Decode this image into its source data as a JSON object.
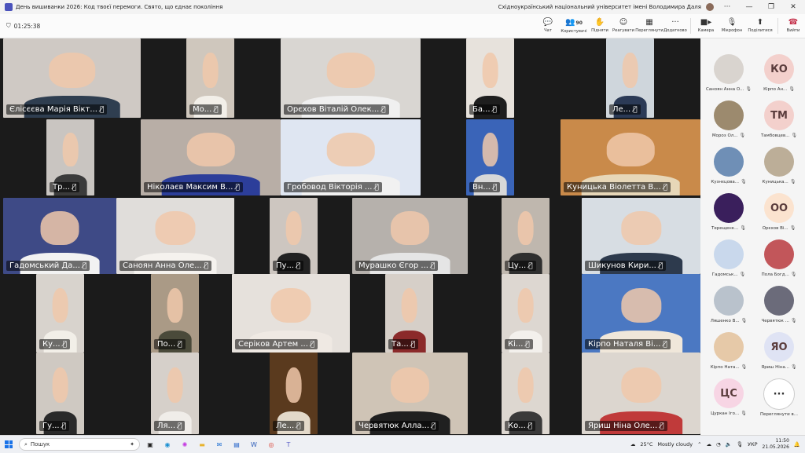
{
  "window": {
    "title": "День вишиванки 2026: Код твоєї перемоги. Свято, що єднає покоління",
    "org": "Східноукраїнський національний університет імені Володимира Даля"
  },
  "toolbar": {
    "timer": "01:25:38",
    "chat": "Чат",
    "people": "Користувачі",
    "people_count": "90",
    "raise": "Підняти",
    "react": "Реагувати",
    "view": "Переглянути",
    "more": "Додатково",
    "camera": "Камера",
    "mic": "Мікрофон",
    "share": "Поділитися",
    "leave": "Вийти"
  },
  "tiles": [
    {
      "name": "Єлісєєва Марія Вікт...",
      "bg": "#cfc9c4",
      "shirt": "#2f3e50"
    },
    {
      "name": "Мо...",
      "bg": "#cfc7bd",
      "shirt": "#f2efe9"
    },
    {
      "name": "Орєхов Віталій Олек...",
      "bg": "#d9d6d2",
      "shirt": "#f0f0f0"
    },
    {
      "name": "Ба...",
      "bg": "#e7e2dc",
      "shirt": "#1e1e1e"
    },
    {
      "name": "Ле...",
      "bg": "#cfd6dc",
      "shirt": "#2b3a56"
    },
    {
      "name": "Тр...",
      "bg": "#c9c5c1",
      "shirt": "#3b3b3b"
    },
    {
      "name": "Ніколаєв Максим В...",
      "bg": "#b8aea6",
      "shirt": "#2c3e9a"
    },
    {
      "name": "Гробовод Вікторія ...",
      "bg": "#dfe6f2",
      "shirt": "#f1f1f1"
    },
    {
      "name": "Вн...",
      "bg": "#3a64b8",
      "shirt": "#d8d8d8"
    },
    {
      "name": "Куницька Віолетта В...",
      "bg": "#c98a4a",
      "shirt": "#e7d7b8"
    },
    {
      "name": "Гадомський Да...",
      "bg": "#3e4a86",
      "shirt": "#f2f2f2"
    },
    {
      "name": "Саноян Анна Оле...",
      "bg": "#e0ddda",
      "shirt": "#f5f2ee"
    },
    {
      "name": "Пу...",
      "bg": "#cdc6c0",
      "shirt": "#222"
    },
    {
      "name": "Мурашко Єгор ...",
      "bg": "#b6b1ac",
      "shirt": "#e5e5e5"
    },
    {
      "name": "Цу...",
      "bg": "#bfb7ae",
      "shirt": "#2f2f2f"
    },
    {
      "name": "Шикунов Кири...",
      "bg": "#d7dde3",
      "shirt": "#2d3a4d"
    },
    {
      "name": "Ку...",
      "bg": "#d8d3cd",
      "shirt": "#f2efe8"
    },
    {
      "name": "По...",
      "bg": "#aa9a86",
      "shirt": "#4a4a3a"
    },
    {
      "name": "Серіков Артем ...",
      "bg": "#e6e1dc",
      "shirt": "#efe9e3"
    },
    {
      "name": "Та...",
      "bg": "#d6cfc8",
      "shirt": "#8b2a2a"
    },
    {
      "name": "Кі...",
      "bg": "#ddd7d1",
      "shirt": "#f3f0ec"
    },
    {
      "name": "Кірпо Наталя Ві...",
      "bg": "#4b78c2",
      "shirt": "#f0e7da"
    },
    {
      "name": "Гу...",
      "bg": "#cfc9c2",
      "shirt": "#2a2a2a"
    },
    {
      "name": "Ля...",
      "bg": "#d6d0ca",
      "shirt": "#f0ede9"
    },
    {
      "name": "Ле...",
      "bg": "#5a3a1e",
      "shirt": "#e3d9c9"
    },
    {
      "name": "Чер­вятюк Алла...",
      "bg": "#cfc4b6",
      "shirt": "#202020"
    },
    {
      "name": "Ко...",
      "bg": "#ddd7d0",
      "shirt": "#3a3a3a"
    },
    {
      "name": "Яриш Ніна Оле...",
      "bg": "#dcd6cf",
      "shirt": "#c03a3a"
    }
  ],
  "roster": [
    {
      "label": "Саноян Анна О...",
      "initials": "",
      "color": "#d9d4cf"
    },
    {
      "label": "Кірпо Ан...",
      "initials": "КО",
      "color": "#f3d0cc"
    },
    {
      "label": "Мороз Ол...",
      "initials": "",
      "color": "#9c8a6e"
    },
    {
      "label": "Тамбовцев...",
      "initials": "ТМ",
      "color": "#f3d0cc"
    },
    {
      "label": "Кузнєцова...",
      "initials": "",
      "color": "#6f8fb6"
    },
    {
      "label": "Куницька...",
      "initials": "",
      "color": "#bcae98"
    },
    {
      "label": "Терещенк...",
      "initials": "",
      "color": "#3a1f5c"
    },
    {
      "label": "Орєхов Ві...",
      "initials": "ОО",
      "color": "#fbe3cf"
    },
    {
      "label": "Гадомськ...",
      "initials": "",
      "color": "#c9d8ec"
    },
    {
      "label": "Пола Богд...",
      "initials": "",
      "color": "#c2565a"
    },
    {
      "label": "Ляшенко В...",
      "initials": "",
      "color": "#b9c2cc"
    },
    {
      "label": "Червятюк ...",
      "initials": "",
      "color": "#6b6b7a"
    },
    {
      "label": "Кірпо Ната...",
      "initials": "",
      "color": "#e6c9a8"
    },
    {
      "label": "Яриш Ніна...",
      "initials": "ЯО",
      "color": "#dfe3f4"
    },
    {
      "label": "Цуркан Іго...",
      "initials": "ЦС",
      "color": "#f7d5e4"
    },
    {
      "label": "Переглянути в...",
      "initials": "···",
      "color": "#ffffff"
    }
  ],
  "taskbar": {
    "search": "Пошук",
    "weather": "25°C",
    "weather_text": "Mostly cloudy",
    "lang": "УКР",
    "time": "11:50",
    "date": "21.05.2026"
  }
}
